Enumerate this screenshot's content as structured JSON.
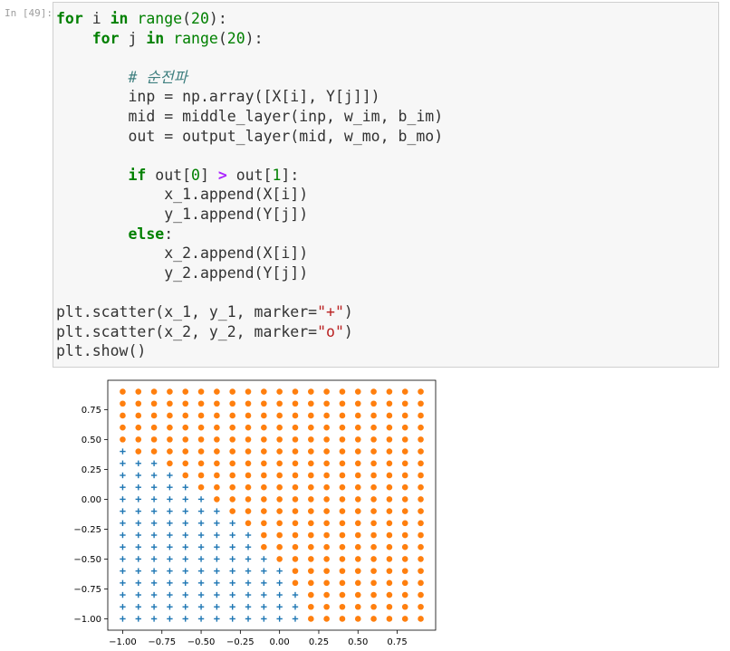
{
  "cell": {
    "prompt": "In [49]:",
    "code_lines": [
      "for i in range(20):",
      "    for j in range(20):",
      "",
      "        # 순전파",
      "        inp = np.array([X[i], Y[j]])",
      "        mid = middle_layer(inp, w_im, b_im)",
      "        out = output_layer(mid, w_mo, b_mo)",
      "",
      "        if out[0] > out[1]:",
      "            x_1.append(X[i])",
      "            y_1.append(Y[j])",
      "        else:",
      "            x_2.append(X[i])",
      "            y_2.append(Y[j])",
      "",
      "plt.scatter(x_1, y_1, marker=\"+\")",
      "plt.scatter(x_2, y_2, marker=\"o\")",
      "plt.show()"
    ]
  },
  "colors": {
    "series_plus": "#1f77b4",
    "series_circle": "#ff7f0e",
    "keyword": "#008000",
    "operator": "#aa22ff",
    "string": "#ba2121",
    "comment": "#408080"
  },
  "chart_data": {
    "type": "scatter",
    "x": [
      -1.0,
      -0.9,
      -0.8,
      -0.7,
      -0.6,
      -0.5,
      -0.4,
      -0.3,
      -0.2,
      -0.1,
      0.0,
      0.1,
      0.2,
      0.3,
      0.4,
      0.5,
      0.6,
      0.7,
      0.8,
      0.9
    ],
    "y": [
      -1.0,
      -0.9,
      -0.8,
      -0.7,
      -0.6,
      -0.5,
      -0.4,
      -0.3,
      -0.2,
      -0.1,
      0.0,
      0.1,
      0.2,
      0.3,
      0.4,
      0.5,
      0.6,
      0.7,
      0.8,
      0.9
    ],
    "plus_max_y_index_per_x": [
      15,
      14,
      14,
      13,
      12,
      11,
      10,
      9,
      8,
      6,
      5,
      3,
      0,
      0,
      0,
      0,
      0,
      0,
      0,
      0
    ],
    "series": [
      {
        "marker": "+",
        "color": "#1f77b4",
        "rule": "points with y index < plus_max_y_index_per_x[x index]"
      },
      {
        "marker": "o",
        "color": "#ff7f0e",
        "rule": "all remaining grid points"
      }
    ],
    "xlim": [
      -1.095,
      0.995
    ],
    "ylim": [
      -1.095,
      0.995
    ],
    "xticks": [
      -1.0,
      -0.75,
      -0.5,
      -0.25,
      0.0,
      0.25,
      0.5,
      0.75
    ],
    "yticks": [
      -1.0,
      -0.75,
      -0.5,
      -0.25,
      0.0,
      0.25,
      0.5,
      0.75
    ],
    "xtick_labels": [
      "−1.00",
      "−0.75",
      "−0.50",
      "−0.25",
      "0.00",
      "0.25",
      "0.50",
      "0.75"
    ],
    "ytick_labels": [
      "−1.00",
      "−0.75",
      "−0.50",
      "−0.25",
      "0.00",
      "0.25",
      "0.50",
      "0.75"
    ],
    "grid": false,
    "title": "",
    "xlabel": "",
    "ylabel": ""
  }
}
